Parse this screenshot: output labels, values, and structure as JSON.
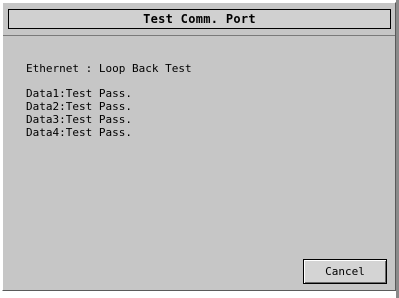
{
  "dialog": {
    "title": "Test Comm. Port",
    "test_heading": "Ethernet : Loop Back Test",
    "results": [
      "Data1:Test Pass.",
      "Data2:Test Pass.",
      "Data3:Test Pass.",
      "Data4:Test Pass."
    ],
    "cancel_label": "Cancel"
  },
  "colors": {
    "background": "#c6c6c6",
    "title_bar": "#d0d0d0",
    "text": "#000000"
  }
}
